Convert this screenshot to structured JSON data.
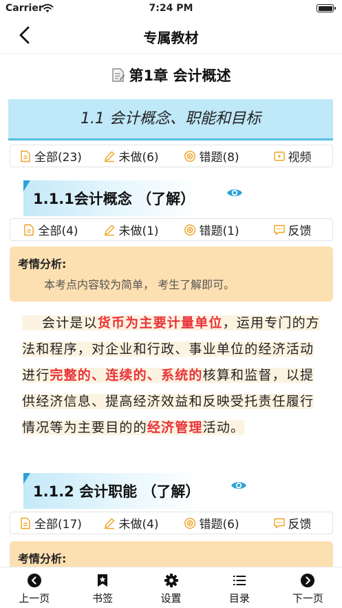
{
  "status_bar": {
    "carrier": "Carrier",
    "time": "7:24 PM"
  },
  "nav": {
    "title": "专属教材"
  },
  "chapter": {
    "title": "第1章 会计概述"
  },
  "section": {
    "title": "1.1 会计概念、职能和目标"
  },
  "section_filters": [
    {
      "label": "全部(23)",
      "icon": "document-icon"
    },
    {
      "label": "未做(6)",
      "icon": "pencil-icon"
    },
    {
      "label": "错题(8)",
      "icon": "error-icon"
    },
    {
      "label": "视频",
      "icon": "video-icon"
    }
  ],
  "subsections": [
    {
      "title": "1.1.1会计概念 （了解）",
      "filters": [
        {
          "label": "全部(4)",
          "icon": "document-icon"
        },
        {
          "label": "未做(1)",
          "icon": "pencil-icon"
        },
        {
          "label": "错题(1)",
          "icon": "error-icon"
        },
        {
          "label": "反馈",
          "icon": "feedback-icon"
        }
      ],
      "analysis_label": "考情分析:",
      "analysis_text": "本考点内容较为简单， 考生了解即可。",
      "paragraph": {
        "p1": "会计是以",
        "h1": "货币为主要计量单位",
        "p2": "，运用专门的方法和程序，对企业和行政、事业单位的经济活动进行",
        "h2": "完整的、连续的、系统的",
        "p3": "核算和监督，以提供经济信息、提高经济效益和反映受托责任履行情况等为主要目的的",
        "h3": "经济管理",
        "p4": "活动。"
      }
    },
    {
      "title": "1.1.2 会计职能 （了解）",
      "filters": [
        {
          "label": "全部(17)",
          "icon": "document-icon"
        },
        {
          "label": "未做(4)",
          "icon": "pencil-icon"
        },
        {
          "label": "错题(6)",
          "icon": "error-icon"
        },
        {
          "label": "反馈",
          "icon": "feedback-icon"
        }
      ],
      "analysis_label": "考情分析:"
    }
  ],
  "tabbar": [
    {
      "label": "上一页",
      "icon": "prev-page-icon"
    },
    {
      "label": "书签",
      "icon": "bookmark-icon"
    },
    {
      "label": "设置",
      "icon": "settings-gear-icon"
    },
    {
      "label": "目录",
      "icon": "catalog-list-icon"
    },
    {
      "label": "下一页",
      "icon": "next-page-icon"
    }
  ],
  "colors": {
    "accent_blue": "#2aa3d8",
    "banner_bg": "#bfe8f8",
    "filter_icon": "#f0a020",
    "analysis_bg": "#fde0b2",
    "highlight_red": "#e8343a"
  }
}
